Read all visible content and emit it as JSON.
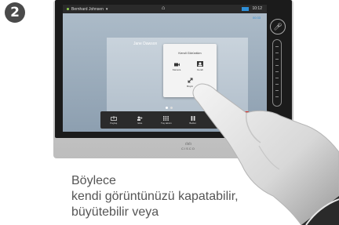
{
  "step": {
    "number": "2"
  },
  "status_bar": {
    "user": "Bernhard Johnsen",
    "time": "10:12"
  },
  "call": {
    "remote_name": "Jane Dawson",
    "duration": "00:33"
  },
  "self_view_panel": {
    "title": "Kendi Görüntüm",
    "buttons": [
      {
        "label": "Kamera"
      },
      {
        "label": "Kendi"
      },
      {
        "label": "Büyüt"
      }
    ]
  },
  "toolbar": {
    "items": [
      {
        "label": "Paylaş"
      },
      {
        "label": "Ekle"
      },
      {
        "label": "Tuş takımı"
      },
      {
        "label": "Beklet"
      },
      {
        "label": "Aktar"
      }
    ]
  },
  "device": {
    "brand": "CISCO"
  },
  "caption": {
    "line1": "Böylece",
    "line2": "kendi görüntünüzü kapatabilir,",
    "line3": "büyütebilir veya"
  },
  "colors": {
    "accent": "#2e8fd8",
    "end_call": "#d9342b"
  }
}
